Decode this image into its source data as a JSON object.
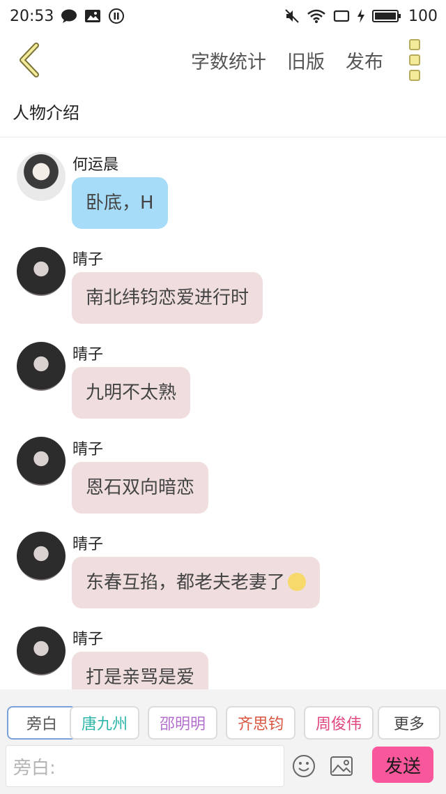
{
  "status_bar": {
    "time": "20:53",
    "battery": "100"
  },
  "toolbar": {
    "word_count": "字数统计",
    "old_version": "旧版",
    "publish": "发布"
  },
  "section": {
    "title": "人物介绍"
  },
  "messages": [
    {
      "name": "何运晨",
      "text": "卧底，H"
    },
    {
      "name": "晴子",
      "text": "南北纬钧恋爱进行时"
    },
    {
      "name": "晴子",
      "text": "九明不太熟"
    },
    {
      "name": "晴子",
      "text": "恩石双向暗恋"
    },
    {
      "name": "晴子",
      "text": "东春互掐，都老夫老妻了"
    },
    {
      "name": "晴子",
      "text": "打是亲骂是爱"
    }
  ],
  "characters": [
    {
      "label": "旁白",
      "color": "#555555"
    },
    {
      "label": "唐九州",
      "color": "#2cb5a8"
    },
    {
      "label": "邵明明",
      "color": "#b36fcc"
    },
    {
      "label": "齐思钧",
      "color": "#d9553f"
    },
    {
      "label": "周俊伟",
      "color": "#e0457f"
    },
    {
      "label": "更多",
      "color": "#444444"
    }
  ],
  "input": {
    "placeholder": "旁白:"
  },
  "send": {
    "label": "发送"
  },
  "colors": {
    "accent_yellow": "#f3ea9a",
    "send_pink": "#f8579b",
    "bubble_blue": "#a6dcf7",
    "bubble_pink": "#efdedd"
  }
}
